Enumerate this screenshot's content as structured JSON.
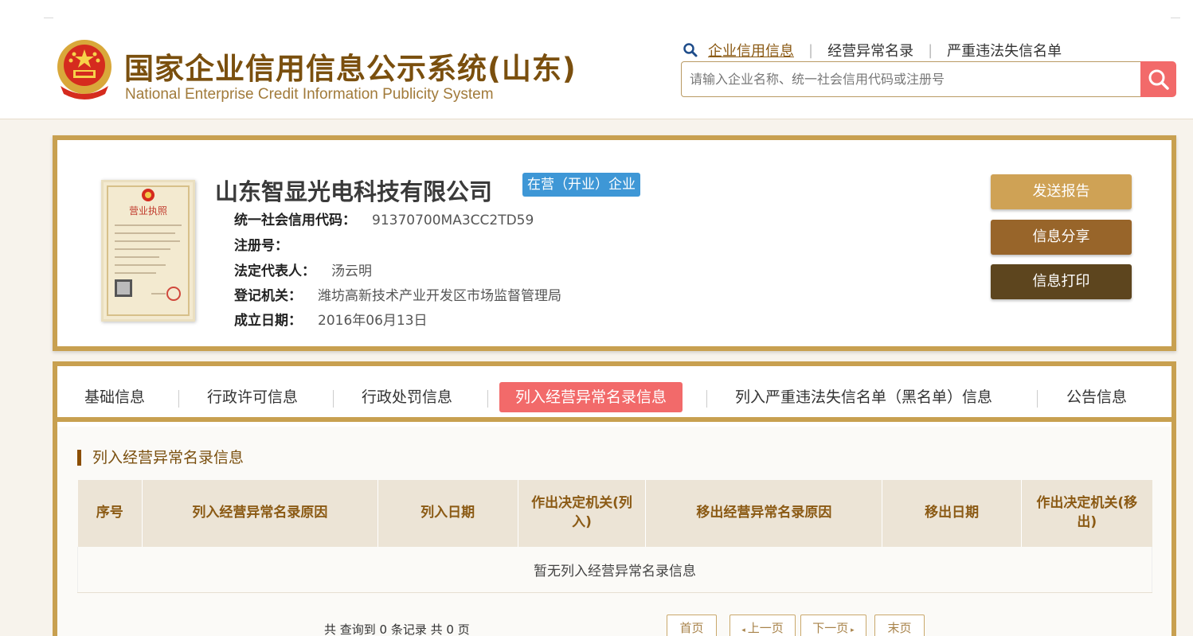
{
  "site": {
    "title": "国家企业信用信息公示系统(山东)",
    "subtitle": "National Enterprise Credit Information Publicity System"
  },
  "topnav": {
    "items": [
      "企业信用信息",
      "经营异常名录",
      "严重违法失信名单"
    ]
  },
  "search": {
    "placeholder": "请输入企业名称、统一社会信用代码或注册号"
  },
  "company": {
    "name": "山东智显光电科技有限公司",
    "status": "在营（开业）企业",
    "fields": [
      {
        "label": "统一社会信用代码：",
        "value": "91370700MA3CC2TD59"
      },
      {
        "label": "注册号：",
        "value": ""
      },
      {
        "label": "法定代表人：",
        "value": "汤云明"
      },
      {
        "label": "登记机关：",
        "value": "潍坊高新技术产业开发区市场监督管理局"
      },
      {
        "label": "成立日期：",
        "value": "2016年06月13日"
      }
    ],
    "license_label": "营业执照"
  },
  "actions": {
    "report": "发送报告",
    "share": "信息分享",
    "print": "信息打印"
  },
  "tabs": [
    "基础信息",
    "行政许可信息",
    "行政处罚信息",
    "列入经营异常名录信息",
    "列入严重违法失信名单（黑名单）信息",
    "公告信息"
  ],
  "section": {
    "title": "列入经营异常名录信息",
    "columns": [
      "序号",
      "列入经营异常名录原因",
      "列入日期",
      "作出决定机关(列入)",
      "移出经营异常名录原因",
      "移出日期",
      "作出决定机关(移出)"
    ],
    "empty_text": "暂无列入经营异常名录信息"
  },
  "pager": {
    "info": "共 查询到 0 条记录 共 0 页",
    "first": "首页",
    "prev": "上一页",
    "next": "下一页",
    "last": "末页"
  },
  "colors": {
    "brand_brown": "#7a4f0e",
    "gold_border": "#c8a050",
    "accent_red": "#f26a6a",
    "badge_blue": "#3e97d6"
  },
  "icons": [
    "national-emblem-icon",
    "search-icon",
    "magnifier-icon",
    "arrow-left-icon",
    "arrow-right-icon"
  ]
}
